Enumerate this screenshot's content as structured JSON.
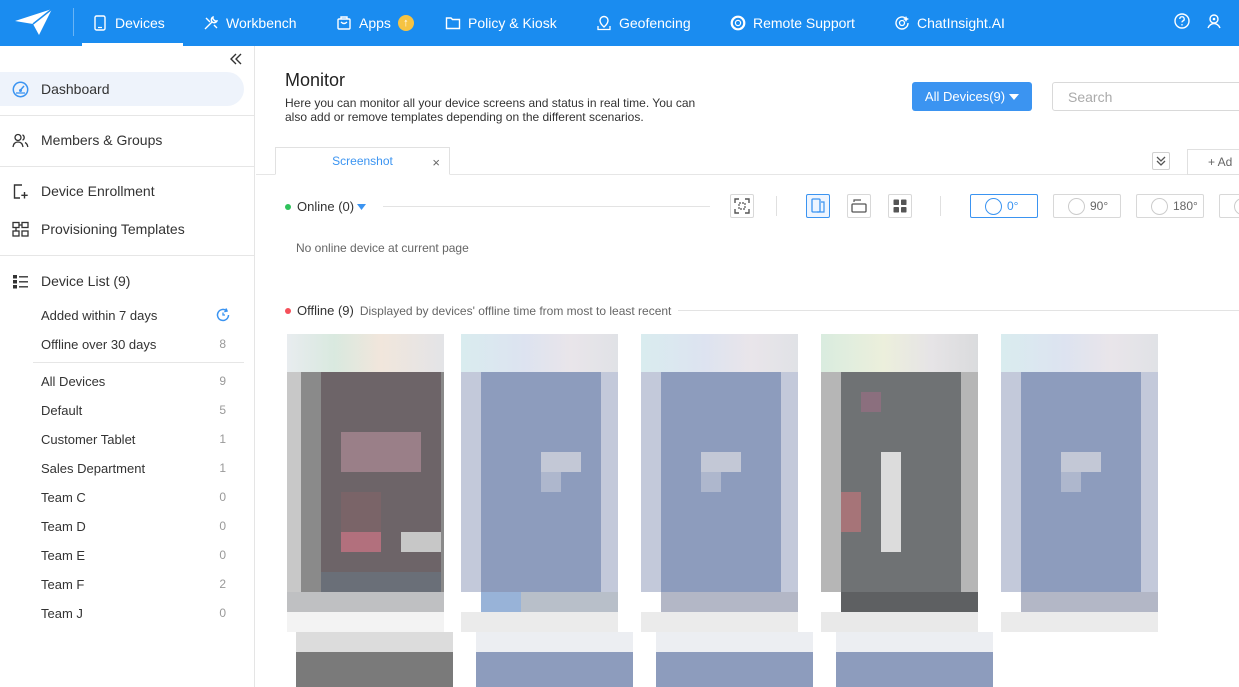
{
  "nav": {
    "items": [
      {
        "label": "Devices",
        "icon": "phone-icon",
        "active": true
      },
      {
        "label": "Workbench",
        "icon": "tools-icon"
      },
      {
        "label": "Apps",
        "icon": "bag-icon",
        "badge": "upgrade-arrow-icon"
      },
      {
        "label": "Policy & Kiosk",
        "icon": "folder-icon"
      },
      {
        "label": "Geofencing",
        "icon": "map-pin-icon"
      },
      {
        "label": "Remote Support",
        "icon": "lifebuoy-icon"
      },
      {
        "label": "ChatInsight.AI",
        "icon": "chat-ai-icon"
      }
    ],
    "right_icons": [
      "help-icon",
      "user-icon"
    ]
  },
  "sidebar": {
    "items": [
      {
        "label": "Dashboard",
        "icon": "dashboard-icon",
        "active": true
      },
      {
        "label": "Members & Groups",
        "icon": "users-icon"
      },
      {
        "label": "Device Enrollment",
        "icon": "enroll-icon"
      },
      {
        "label": "Provisioning Templates",
        "icon": "template-icon"
      },
      {
        "label": "Device List (9)",
        "icon": "list-icon"
      }
    ],
    "quick_filters": [
      {
        "label": "Added within 7 days",
        "icon": "refresh-icon"
      },
      {
        "label": "Offline over 30 days",
        "count": "8"
      }
    ],
    "groups": [
      {
        "label": "All Devices",
        "count": "9"
      },
      {
        "label": "Default",
        "count": "5"
      },
      {
        "label": "Customer Tablet",
        "count": "1"
      },
      {
        "label": "Sales Department",
        "count": "1"
      },
      {
        "label": "Team C",
        "count": "0"
      },
      {
        "label": "Team D",
        "count": "0"
      },
      {
        "label": "Team E",
        "count": "0"
      },
      {
        "label": "Team F",
        "count": "2"
      },
      {
        "label": "Team J",
        "count": "0"
      }
    ]
  },
  "main": {
    "title": "Monitor",
    "description": "Here you can monitor all your device screens and status in real time. You can also add or remove templates depending on the different scenarios.",
    "devices_filter": "All Devices(9)",
    "search_placeholder": "Search",
    "tab": {
      "label": "Screenshot",
      "close": "×"
    },
    "add_label": "+ Ad",
    "online": {
      "label": "Online (0)",
      "empty_text": "No online device at current page",
      "dot_color": "#2fc25b"
    },
    "rotations": [
      "0°",
      "90°",
      "180°"
    ],
    "offline": {
      "label": "Offline (9)",
      "note": "Displayed by devices' offline time from most to least recent",
      "dot_color": "#f5505a"
    }
  },
  "colors": {
    "brand": "#1a8cf0",
    "accent": "#3b94f1"
  }
}
